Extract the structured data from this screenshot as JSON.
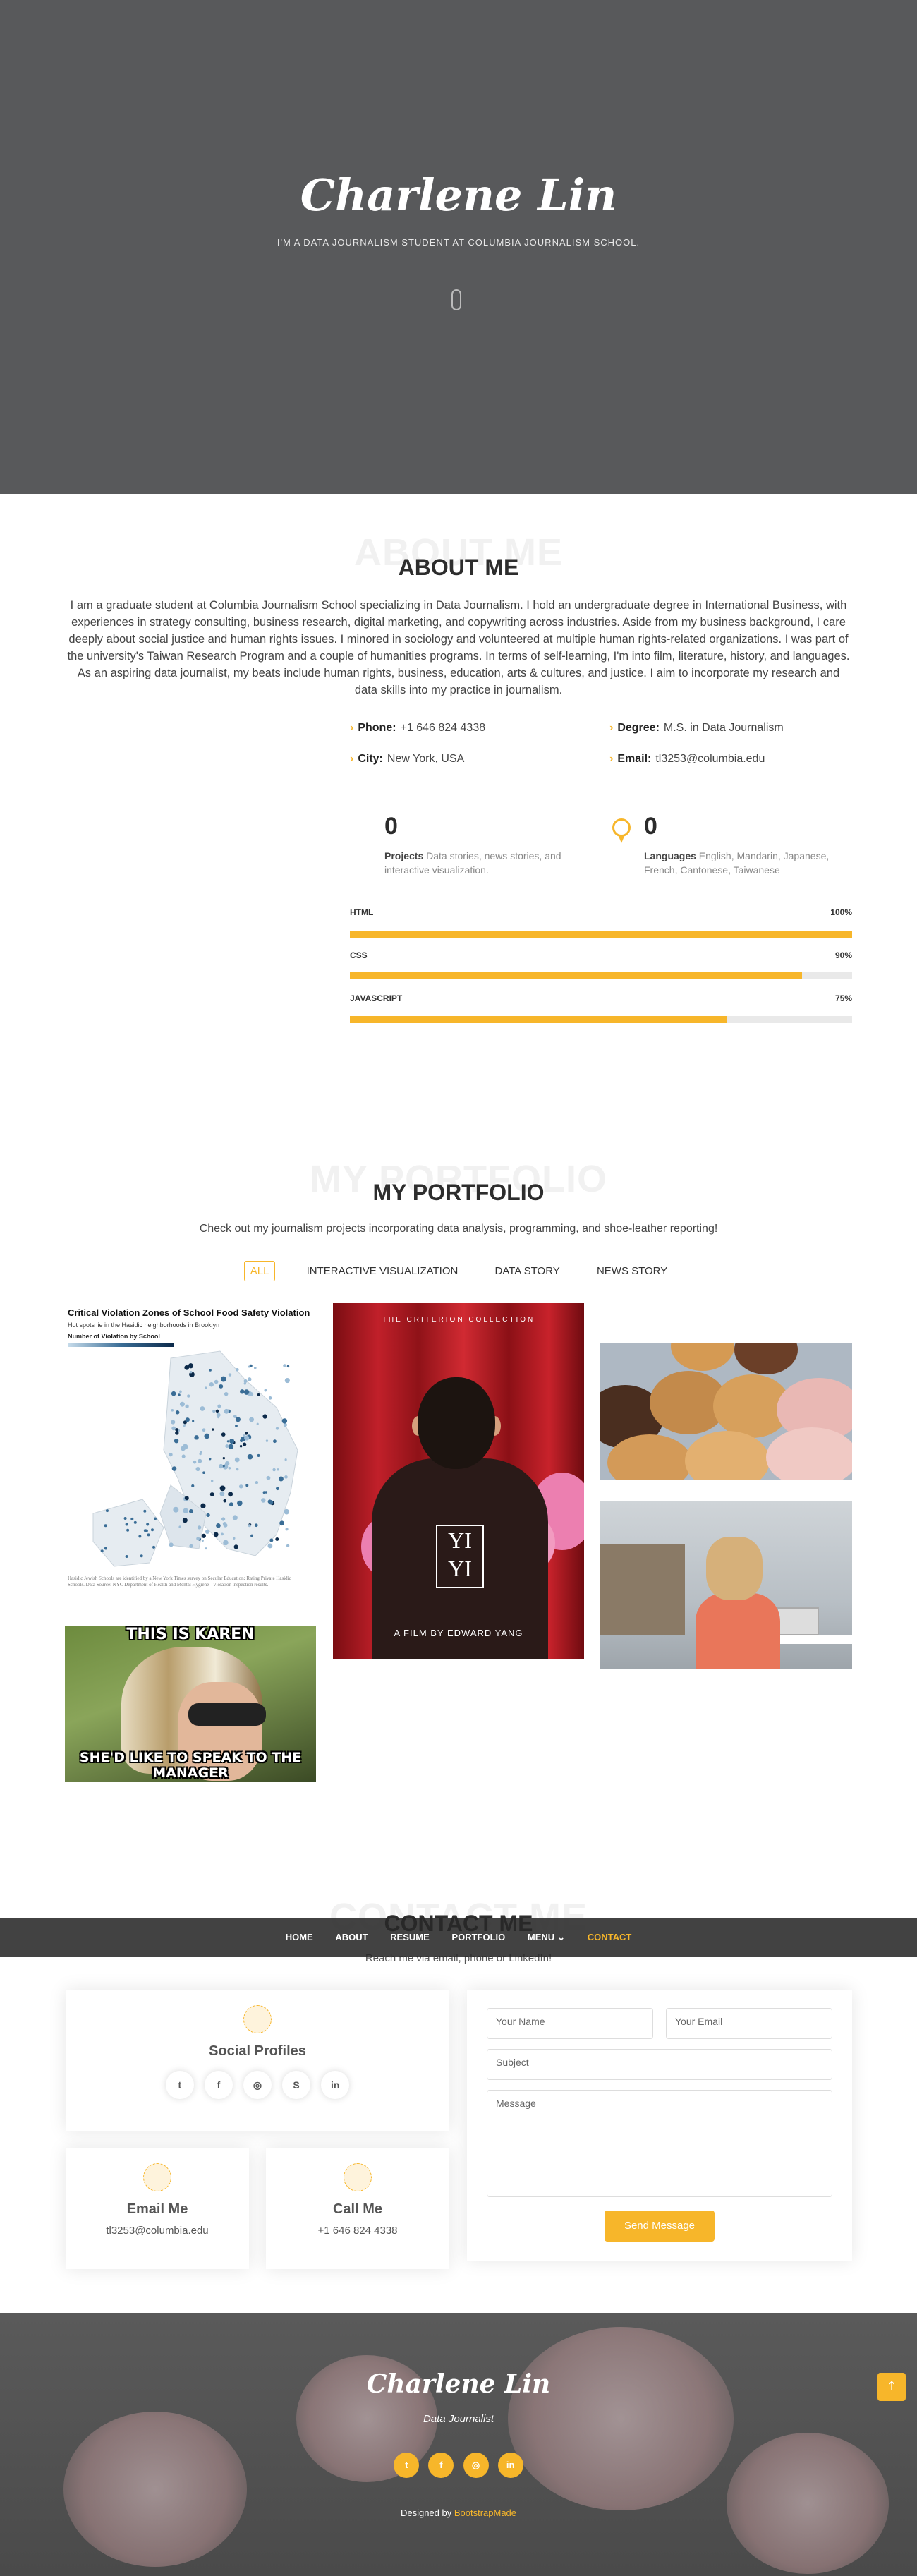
{
  "hero": {
    "name": "Charlene Lin",
    "subtitle": "I'M A DATA JOURNALISM STUDENT AT COLUMBIA JOURNALISM SCHOOL."
  },
  "about": {
    "title_bg": "ABOUT ME",
    "title": "ABOUT ME",
    "paragraph": "I am a graduate student at Columbia Journalism School specializing in Data Journalism. I hold an undergraduate degree in International Business, with experiences in strategy consulting, business research, digital marketing, and copywriting across industries. Aside from my business background, I care deeply about social justice and human rights issues. I minored in sociology and volunteered at multiple human rights-related organizations. I was part of the university's Taiwan Research Program and a couple of humanities programs. In terms of self-learning, I'm into film, literature, history, and languages. As an aspiring data journalist, my beats include human rights, business, education, arts & cultures, and justice. I aim to incorporate my research and data skills into my practice in journalism.",
    "info": [
      {
        "label": "Phone:",
        "value": "+1 646 824 4338"
      },
      {
        "label": "Degree:",
        "value": "M.S. in Data Journalism"
      },
      {
        "label": "City:",
        "value": "New York, USA"
      },
      {
        "label": "Email:",
        "value": "tl3253@columbia.edu"
      }
    ],
    "counters": [
      {
        "number": "0",
        "label": "Projects",
        "text": "Data stories, news stories, and interactive visualization."
      },
      {
        "number": "0",
        "label": "Languages",
        "text": "English, Mandarin, Japanese, French, Cantonese, Taiwanese"
      }
    ],
    "skills": [
      {
        "name": "HTML",
        "value_label": "100%",
        "value": 1.0
      },
      {
        "name": "CSS",
        "value_label": "90%",
        "value": 0.9
      },
      {
        "name": "JAVASCRIPT",
        "value_label": "75%",
        "value": 0.75
      }
    ]
  },
  "portfolio": {
    "title_bg": "MY PORTFOLIO",
    "title": "MY PORTFOLIO",
    "intro": "Check out my journalism projects incorporating data analysis, programming, and shoe-leather reporting!",
    "filters": [
      "ALL",
      "INTERACTIVE VISUALIZATION",
      "DATA STORY",
      "NEWS STORY"
    ],
    "map": {
      "title": "Critical Violation Zones of School Food Safety Violation",
      "subtitle": "Hot spots lie in the Hasidic neighborhoods in Brooklyn",
      "legend_label": "Number of Violation by School",
      "note": "Hasidic Jewish Schools are identified by a New York Times survey on Secular Education; Rating Private Hasidic Schools. Data Source: NYC Department of Health and Mental Hygiene - Violation inspection results."
    },
    "yiyi": {
      "collection": "THE CRITERION COLLECTION",
      "logo_top": "YI",
      "logo_bottom": "YI",
      "film": "A FILM BY EDWARD YANG"
    },
    "karen": {
      "top": "THIS IS KAREN",
      "bottom": "SHE'D LIKE TO SPEAK TO THE MANAGER"
    }
  },
  "nav": [
    "HOME",
    "ABOUT",
    "RESUME",
    "PORTFOLIO",
    "MENU",
    "CONTACT"
  ],
  "contact": {
    "title_bg": "CONTACT ME",
    "title": "CONTACT ME",
    "subtitle": "Reach me via email, phone or LinkedIn!",
    "social_title": "Social Profiles",
    "social_icons": [
      "twitter-icon",
      "facebook-icon",
      "instagram-icon",
      "skype-icon",
      "linkedin-icon"
    ],
    "email_title": "Email Me",
    "email": "tl3253@columbia.edu",
    "call_title": "Call Me",
    "phone": "+1 646 824 4338",
    "form": {
      "name_placeholder": "Your Name",
      "email_placeholder": "Your Email",
      "subject_placeholder": "Subject",
      "message_placeholder": "Message",
      "send_label": "Send Message"
    }
  },
  "footer": {
    "name": "Charlene Lin",
    "role": "Data Journalist",
    "credit_prefix": "Designed by ",
    "credit_link": "BootstrapMade"
  },
  "colors": {
    "accent": "#f7b62a",
    "hero_bg": "#58595b"
  }
}
